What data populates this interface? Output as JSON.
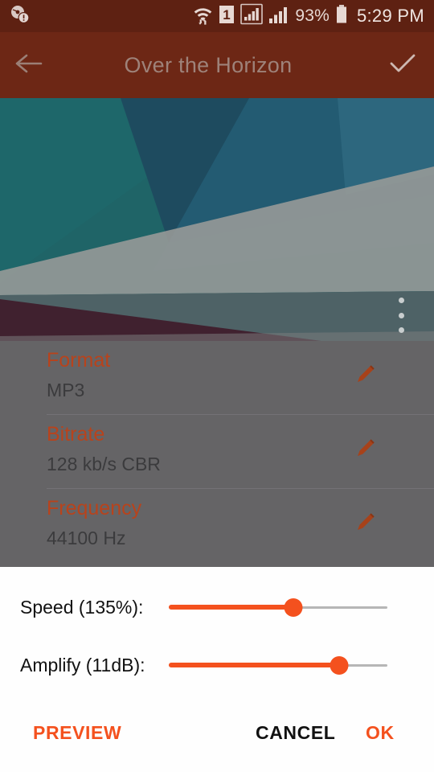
{
  "status_bar": {
    "left_icons": [
      {
        "name": "disc-warning-icon",
        "glyph": "disc-alert"
      }
    ],
    "right_icons": [
      {
        "name": "wifi-transfer-icon",
        "glyph": "wifi"
      },
      {
        "name": "sim-1-icon",
        "glyph": "1"
      },
      {
        "name": "signal-boxed-icon",
        "glyph": "signal-box"
      },
      {
        "name": "signal-bars-icon",
        "glyph": "signal"
      }
    ],
    "battery_percent": "93%",
    "time": "5:29 PM",
    "background_color": "#5e2112"
  },
  "toolbar": {
    "back_label": "Back",
    "title": "Over the Horizon",
    "confirm_label": "Done",
    "background_color": "#6d2715",
    "title_color": "#9e8279"
  },
  "artwork": {
    "overflow_label": "More options",
    "colors": {
      "teal": "#0b6e72",
      "deep_teal": "#0a5a63",
      "navy": "#0a4a66",
      "blue": "#146a8c",
      "slate": "#55666b",
      "light_grey": "#b9bcb8",
      "maroon": "#3a0e22"
    }
  },
  "details": {
    "rows": [
      {
        "label": "Format",
        "value": "MP3",
        "edit_label": "Edit format"
      },
      {
        "label": "Bitrate",
        "value": "128 kb/s CBR",
        "edit_label": "Edit bitrate"
      },
      {
        "label": "Frequency",
        "value": "44100 Hz",
        "edit_label": "Edit frequency"
      }
    ],
    "label_color": "#b8431c",
    "scrim_color": "#656466"
  },
  "dialog": {
    "sliders": [
      {
        "name": "speed",
        "label": "Speed (135%):",
        "value": 135,
        "percent": 57,
        "unit": "%"
      },
      {
        "name": "amplify",
        "label": "Amplify (11dB):",
        "value": 11,
        "percent": 78,
        "unit": "dB"
      }
    ],
    "buttons": {
      "preview": "PREVIEW",
      "cancel": "CANCEL",
      "ok": "OK"
    },
    "accent_color": "#f4511e",
    "background_color": "#fefefe"
  }
}
